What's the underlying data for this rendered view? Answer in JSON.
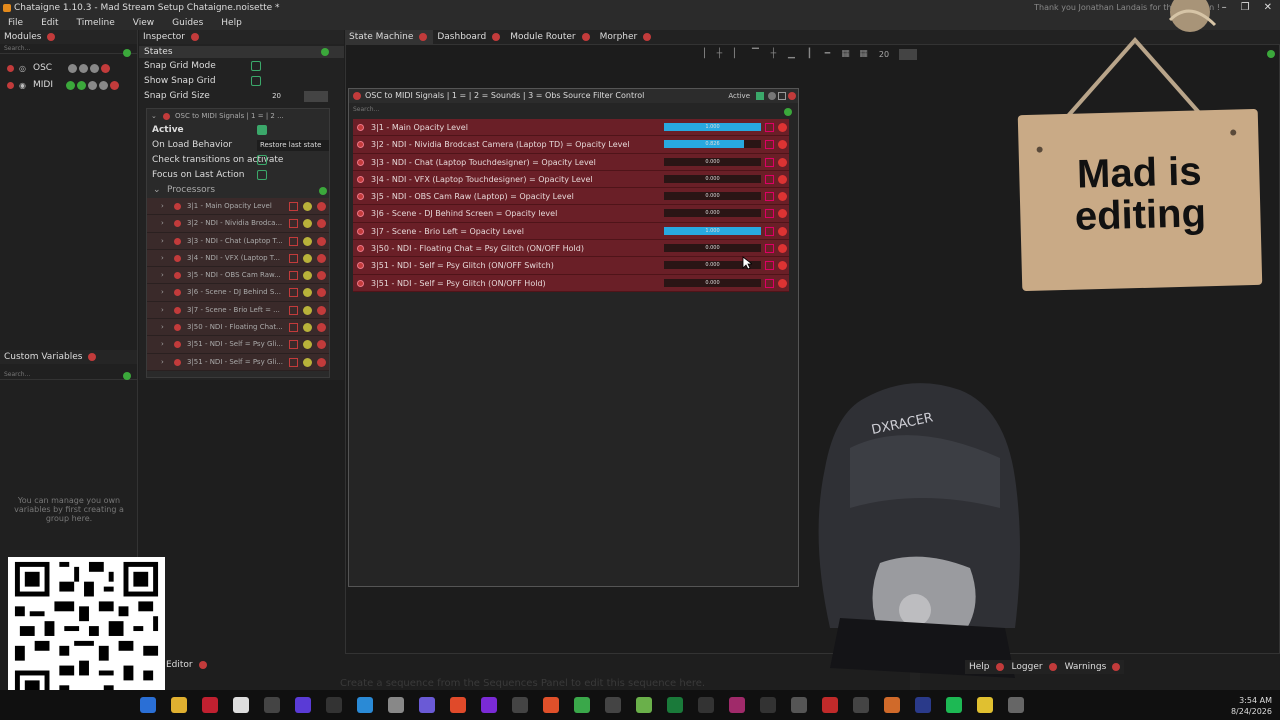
{
  "window": {
    "title": "Chataigne 1.10.3 - Mad Stream Setup Chataigne.noisette *",
    "thanks_text": "Thank you Jonathan Landais for the donation !"
  },
  "menu": [
    "File",
    "Edit",
    "Timeline",
    "View",
    "Guides",
    "Help"
  ],
  "modules": {
    "header": "Modules",
    "search_placeholder": "Search...",
    "items": [
      {
        "name": "OSC",
        "icon": "osc-icon"
      },
      {
        "name": "MIDI",
        "icon": "midi-icon"
      }
    ]
  },
  "custom_variables": {
    "header": "Custom Variables",
    "search_placeholder": "Search...",
    "hint": "You can manage you own variables by first creating a group here."
  },
  "inspector": {
    "header": "Inspector",
    "states_label": "States",
    "snap_grid_mode": "Snap Grid Mode",
    "show_snap_grid": "Show Snap Grid",
    "snap_grid_size": "Snap Grid Size",
    "snap_grid_size_value": "20",
    "state_title": "OSC to MIDI Signals | 1 = | 2 ...",
    "active_label": "Active",
    "on_load_behavior": "On Load Behavior",
    "on_load_value": "Restore last state",
    "check_transitions": "Check transitions on activate",
    "focus_last_action": "Focus on Last Action",
    "processors_label": "Processors",
    "processors": [
      "3|1 - Main Opacity Level",
      "3|2 - NDI - Nividia Brodca...",
      "3|3 - NDI - Chat (Laptop T...",
      "3|4 - NDI - VFX (Laptop T...",
      "3|5 - NDI - OBS Cam Raw...",
      "3|6 - Scene - DJ Behind S...",
      "3|7 - Scene - Brio Left = ...",
      "3|50 - NDI - Floating Chat...",
      "3|51 - NDI - Self = Psy Gli...",
      "3|51 - NDI - Self = Psy Gli..."
    ]
  },
  "tabs": [
    {
      "label": "State Machine",
      "active": true
    },
    {
      "label": "Dashboard",
      "active": false
    },
    {
      "label": "Module Router",
      "active": false
    },
    {
      "label": "Morpher",
      "active": false
    }
  ],
  "toolbar": {
    "grid_size": "20"
  },
  "state_node": {
    "title": "OSC to MIDI Signals | 1 = | 2 = Sounds | 3 = Obs Source Filter Control",
    "active_label": "Active",
    "search_placeholder": "Search...",
    "signals": [
      {
        "label": "3|1 - Main Opacity Level",
        "level": 1.0,
        "value": "1.000"
      },
      {
        "label": "3|2 - NDI - Nividia Brodcast Camera (Laptop TD) = Opacity Level",
        "level": 0.82,
        "value": "0.826"
      },
      {
        "label": "3|3 - NDI - Chat (Laptop Touchdesigner) = Opacity Level",
        "level": 0,
        "value": "0.000"
      },
      {
        "label": "3|4 - NDI - VFX (Laptop Touchdesigner) = Opacity Level",
        "level": 0,
        "value": "0.000"
      },
      {
        "label": "3|5 - NDI - OBS Cam Raw (Laptop) = Opacity Level",
        "level": 0,
        "value": "0.000"
      },
      {
        "label": "3|6 - Scene - DJ Behind Screen = Opacity level",
        "level": 0,
        "value": "0.000"
      },
      {
        "label": "3|7 - Scene - Brio Left = Opacity Level",
        "level": 1.0,
        "value": "1.000"
      },
      {
        "label": "3|50 - NDI - Floating Chat = Psy Glitch (ON/OFF Hold)",
        "level": 0,
        "value": "0.000"
      },
      {
        "label": "3|51 - NDI - Self = Psy Glitch (ON/OFF Switch)",
        "level": 0,
        "value": "0.000"
      },
      {
        "label": "3|51 - NDI - Self = Psy Glitch (ON/OFF Hold)",
        "level": 0,
        "value": "0.000"
      }
    ]
  },
  "sign": {
    "text_line1": "Mad is",
    "text_line2": "editing"
  },
  "bottom": {
    "sequence_hint": "Create a sequence from the Sequences Panel to edit this sequence here.",
    "editor_label": "Editor",
    "help_tab": "Help",
    "logger_tab": "Logger",
    "warnings_tab": "Warnings"
  },
  "taskbar": {
    "time": "3:54 AM",
    "date": "8/24/2026"
  },
  "colors": {
    "accent": "#28a9e0",
    "signal_row": "#6a1f27",
    "power_red": "#c23b3b",
    "ok_green": "#3ba86a"
  }
}
